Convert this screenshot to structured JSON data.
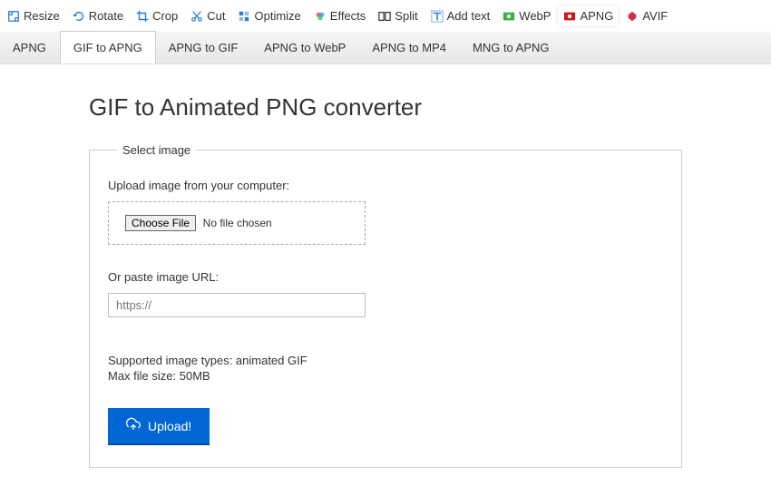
{
  "toolbar": [
    {
      "label": "Resize",
      "icon": "resize",
      "color": "#2a7de1"
    },
    {
      "label": "Rotate",
      "icon": "rotate",
      "color": "#2a7de1"
    },
    {
      "label": "Crop",
      "icon": "crop",
      "color": "#2a7de1"
    },
    {
      "label": "Cut",
      "icon": "cut",
      "color": "#2a7de1"
    },
    {
      "label": "Optimize",
      "icon": "optimize",
      "color": "#2a7de1"
    },
    {
      "label": "Effects",
      "icon": "effects",
      "color": "#d48b2a"
    },
    {
      "label": "Split",
      "icon": "split",
      "color": "#333"
    },
    {
      "label": "Add text",
      "icon": "text",
      "color": "#2a7de1"
    },
    {
      "label": "WebP",
      "icon": "webp",
      "color": "#3cb043"
    },
    {
      "label": "APNG",
      "icon": "apng",
      "color": "#c91b1b",
      "active": true
    },
    {
      "label": "AVIF",
      "icon": "avif",
      "color": "#d62d4c"
    }
  ],
  "tabs": [
    {
      "label": "APNG"
    },
    {
      "label": "GIF to APNG",
      "active": true
    },
    {
      "label": "APNG to GIF"
    },
    {
      "label": "APNG to WebP"
    },
    {
      "label": "APNG to MP4"
    },
    {
      "label": "MNG to APNG"
    }
  ],
  "page": {
    "title": "GIF to Animated PNG converter",
    "fieldset_legend": "Select image",
    "upload_label": "Upload image from your computer:",
    "choose_file_label": "Choose File",
    "no_file_text": "No file chosen",
    "url_label": "Or paste image URL:",
    "url_placeholder": "https://",
    "supported_text": "Supported image types: animated GIF",
    "max_size_text": "Max file size: 50MB",
    "upload_button_label": "Upload!"
  }
}
